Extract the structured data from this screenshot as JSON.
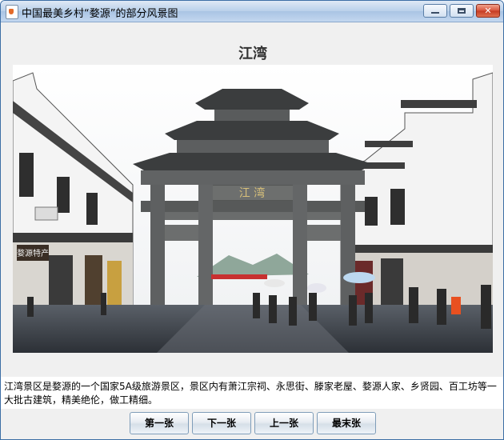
{
  "window": {
    "title": "中国最美乡村“婺源”的部分风景图",
    "minimize_glyph": "minimize-icon",
    "maximize_glyph": "maximize-icon",
    "close_glyph": "✕"
  },
  "main": {
    "heading": "江湾",
    "image": {
      "description_icon": "scenic-photo",
      "gate_inscription": "江 湾",
      "shop_sign": "婺源特产"
    },
    "caption": "江湾景区是婺源的一个国家5A级旅游景区，景区内有萧江宗祠、永思街、滕家老屋、婺源人家、乡贤园、百工坊等一大批古建筑，精美绝伦，做工精细。"
  },
  "buttons": {
    "first": "第一张",
    "next": "下一张",
    "prev": "上一张",
    "last": "最末张"
  }
}
